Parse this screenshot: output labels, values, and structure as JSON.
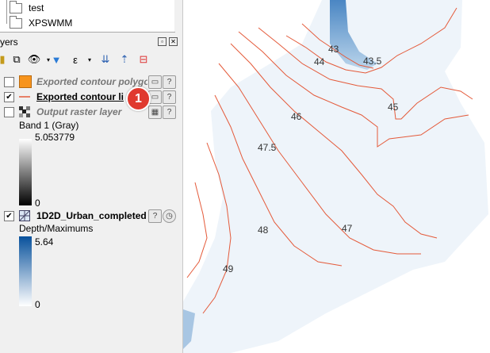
{
  "browser": {
    "items": [
      {
        "label": "test",
        "icon": "folder-icon"
      },
      {
        "label": "XPSWMM",
        "icon": "folder-icon"
      }
    ]
  },
  "layers_panel": {
    "title": "yers",
    "toolbar_icons": [
      "paint-icon",
      "open-layer-styling-icon",
      "manage-map-themes-icon",
      "filter-legend-icon",
      "filter-expression-icon",
      "expand-all-icon",
      "move-up-icon",
      "remove-layer-icon"
    ]
  },
  "layers": [
    {
      "name": "Exported contour polygo",
      "checked": false,
      "symbol": "polygon-fill-icon",
      "italic": true,
      "color": "#f7941d"
    },
    {
      "name": "Exported contour lin",
      "checked": true,
      "symbol": "line-symbol-icon",
      "bold": true,
      "color": "#e45a3a"
    },
    {
      "name": "Output raster layer",
      "checked": false,
      "symbol": "raster-icon",
      "italic": true
    },
    {
      "name": "1D2D_Urban_completed",
      "checked": true,
      "symbol": "mesh-icon",
      "bold": true
    }
  ],
  "legend": {
    "band_label": "Band 1 (Gray)",
    "band_max": "5.053779",
    "band_min": "0",
    "depth_label": "Depth/Maximums",
    "depth_max": "5.64",
    "depth_min": "0"
  },
  "badge": {
    "number": "1"
  },
  "canvas_labels": [
    "43",
    "43.5",
    "44",
    "45",
    "46",
    "47.5",
    "47",
    "48",
    "49"
  ],
  "colors": {
    "contour": "#e45a3a",
    "accent_badge": "#e03a2f",
    "depth_dark": "#08519c"
  }
}
